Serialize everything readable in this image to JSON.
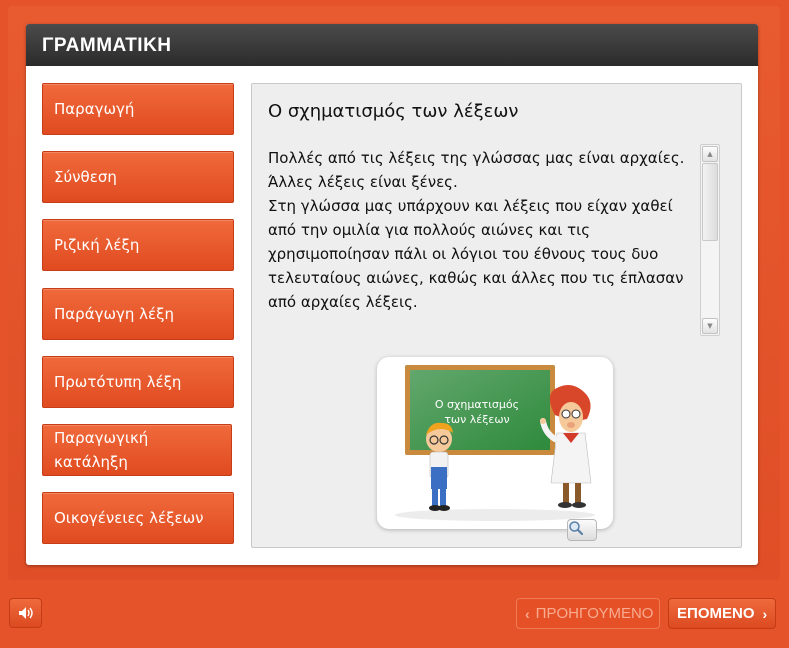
{
  "header": {
    "title": "ΓΡΑΜΜΑΤΙΚΗ"
  },
  "menu": {
    "items": [
      {
        "label": "Παραγωγή"
      },
      {
        "label": "Σύνθεση"
      },
      {
        "label": "Ριζική λέξη"
      },
      {
        "label": "Παράγωγη λέξη"
      },
      {
        "label": "Πρωτότυπη λέξη"
      },
      {
        "label": "Παραγωγική κατάληξη"
      },
      {
        "label": "Οικογένειες λέξεων"
      }
    ]
  },
  "content": {
    "title": "Ο σχηματισμός των λέξεων",
    "paragraphs": [
      "Πολλές από τις λέξεις της γλώσσας μας είναι αρχαίες.",
      "Άλλες λέξεις είναι ξένες.",
      "Στη γλώσσα μας υπάρχουν και λέξεις που είχαν χαθεί από την ομιλία για πολλούς αιώνες και τις χρησιμοποίησαν πάλι οι λόγιοι του έθνους τους δυο τελευταίους αιώνες, καθώς και άλλες που τις έπλασαν από αρχαίες λέξεις."
    ],
    "image": {
      "board_line1": "Ο σχηματισμός",
      "board_line2": "των λέξεων"
    }
  },
  "footer": {
    "prev_label": "ΠΡΟΗΓΟΥΜΕΝΟ",
    "next_label": "ΕΠΟΜΕΝΟ"
  },
  "colors": {
    "accent": "#e4532a",
    "header": "#333333",
    "board": "#2e8a3c"
  },
  "icons": {
    "sound": "speaker-icon",
    "zoom": "magnifier-icon",
    "prev": "chevron-left-icon",
    "next": "chevron-right-icon"
  }
}
